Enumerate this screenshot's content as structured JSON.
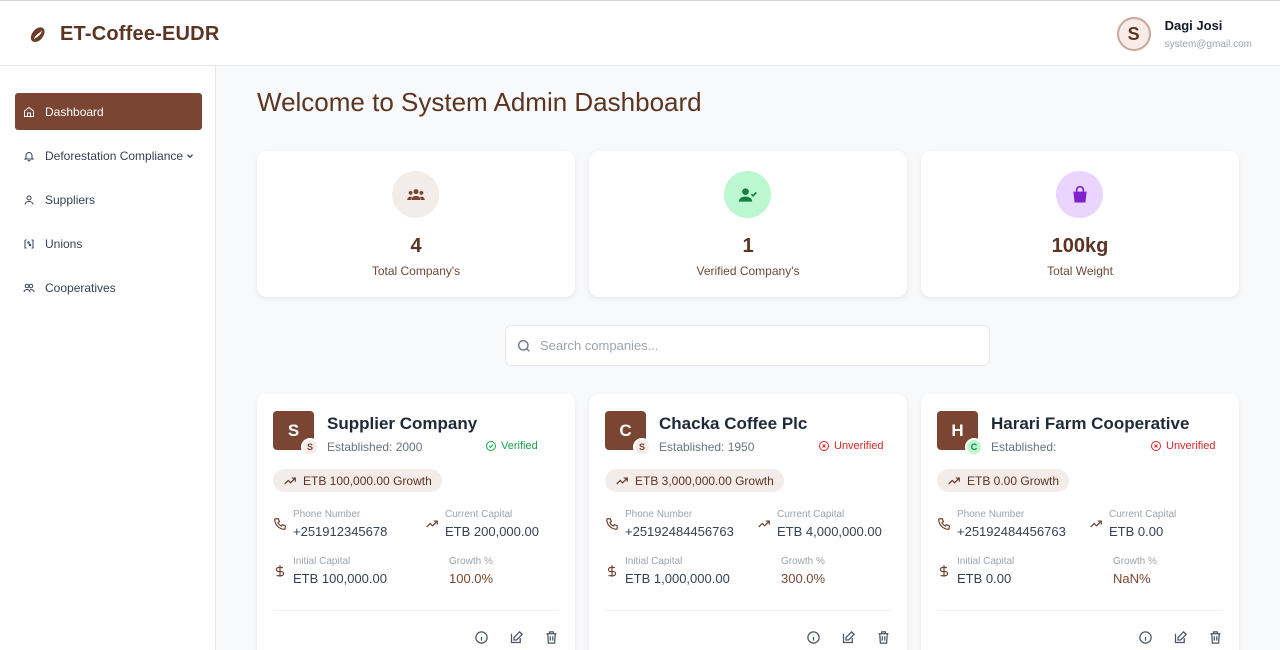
{
  "app": {
    "title": "ET-Coffee-EUDR"
  },
  "user": {
    "initial": "S",
    "name": "Dagi Josi",
    "email": "system@gmail.com"
  },
  "sidebar": {
    "items": [
      {
        "label": "Dashboard",
        "icon": "home-icon"
      },
      {
        "label": "Deforestation Compliance",
        "icon": "bell-icon"
      },
      {
        "label": "Suppliers",
        "icon": "user-icon"
      },
      {
        "label": "Unions",
        "icon": "union-icon"
      },
      {
        "label": "Cooperatives",
        "icon": "users-icon"
      }
    ]
  },
  "page": {
    "title": "Welcome to System Admin Dashboard"
  },
  "stats": [
    {
      "value": "4",
      "label": "Total Company's",
      "icon": "group-icon",
      "bg": "#f4ece9",
      "color": "#7a4532"
    },
    {
      "value": "1",
      "label": "Verified Company's",
      "icon": "user-check-icon",
      "bg": "#bbf7d0",
      "color": "#15803d"
    },
    {
      "value": "100kg",
      "label": "Total Weight",
      "icon": "weight-bag-icon",
      "bg": "#e9d5ff",
      "color": "#7e22ce"
    }
  ],
  "search": {
    "placeholder": "Search companies..."
  },
  "labels": {
    "phone": "Phone Number",
    "current_capital": "Current Capital",
    "initial_capital": "Initial Capital",
    "growth_pct": "Growth %"
  },
  "companies": [
    {
      "initial": "S",
      "sub_initial": "S",
      "sub_bg": "#f4ece9",
      "sub_color": "#7a4532",
      "name": "Supplier Company",
      "established": "Established: 2000",
      "status": "Verified",
      "verified": true,
      "growth": "ETB 100,000.00 Growth",
      "phone": "+251912345678",
      "current_capital": "ETB 200,000.00",
      "initial_capital": "ETB 100,000.00",
      "growth_pct": "100.0%"
    },
    {
      "initial": "C",
      "sub_initial": "S",
      "sub_bg": "#f4ece9",
      "sub_color": "#7a4532",
      "name": "Chacka Coffee Plc",
      "established": "Established: 1950",
      "status": "Unverified",
      "verified": false,
      "growth": "ETB 3,000,000.00 Growth",
      "phone": "+25192484456763",
      "current_capital": "ETB 4,000,000.00",
      "initial_capital": "ETB 1,000,000.00",
      "growth_pct": "300.0%"
    },
    {
      "initial": "H",
      "sub_initial": "C",
      "sub_bg": "#bbf7d0",
      "sub_color": "#15803d",
      "name": "Harari Farm Cooperative",
      "established": "Established:",
      "status": "Unverified",
      "verified": false,
      "growth": "ETB 0.00 Growth",
      "phone": "+25192484456763",
      "current_capital": "ETB 0.00",
      "initial_capital": "ETB 0.00",
      "growth_pct": "NaN%"
    }
  ]
}
